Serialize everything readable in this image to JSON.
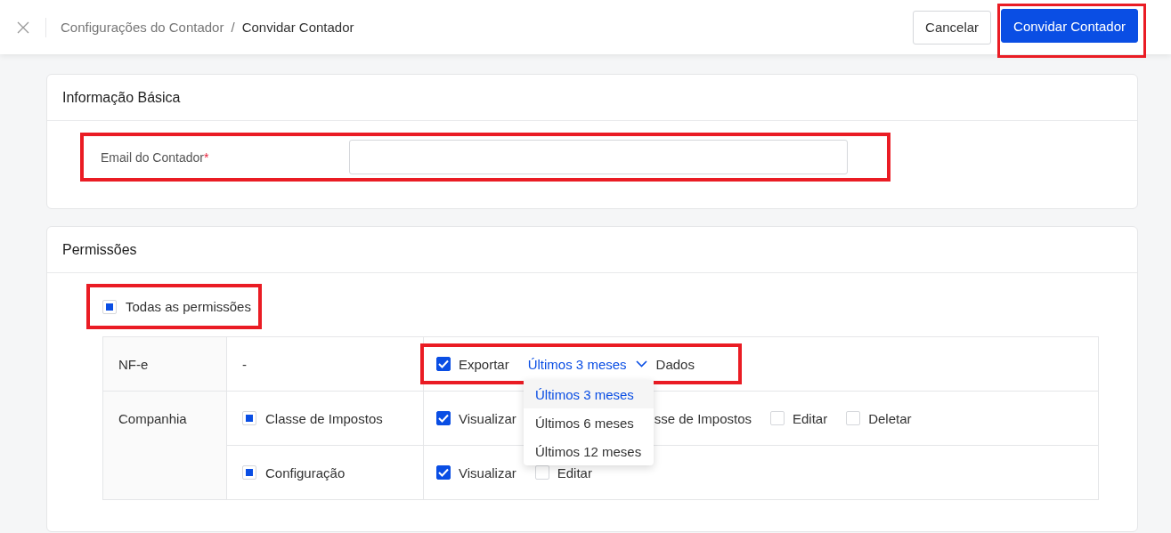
{
  "header": {
    "breadcrumb": [
      {
        "label": "Configurações do Contador",
        "current": false
      },
      {
        "label": "Convidar Contador",
        "current": true
      }
    ],
    "separator": "/",
    "buttons": [
      {
        "label": "Cancelar",
        "kind": "secondary",
        "highlighted": false
      },
      {
        "label": "Convidar Contador",
        "kind": "primary",
        "highlighted": true
      }
    ]
  },
  "basic_info": {
    "title": "Informação Básica",
    "email_field": {
      "label": "Email do Contador",
      "required_mark": "*",
      "highlighted": true
    }
  },
  "permissions": {
    "title": "Permissões",
    "all": {
      "label": "Todas as permissões",
      "checked": false,
      "indeterminate": true,
      "highlighted": true
    },
    "modules": [
      {
        "name": "NF-e",
        "features": [
          {
            "kind": "text",
            "label": "-",
            "highlighted": true,
            "actions": [
              {
                "kind": "check",
                "label": "Exportar",
                "checked": true,
                "indeterminate": false
              },
              {
                "kind": "select",
                "value": "Últimos 3 meses",
                "open": true,
                "options": [
                  {
                    "label": "Últimos 3 meses",
                    "selected": true
                  },
                  {
                    "label": "Últimos 6 meses",
                    "selected": false
                  },
                  {
                    "label": "Últimos 12 meses",
                    "selected": false
                  }
                ]
              },
              {
                "kind": "text",
                "label": "Dados"
              }
            ]
          }
        ]
      },
      {
        "name": "Companhia",
        "features": [
          {
            "kind": "check",
            "label": "Classe de Impostos",
            "checked": false,
            "indeterminate": true,
            "highlighted": false,
            "actions": [
              {
                "kind": "check",
                "label": "Visualizar",
                "checked": true,
                "indeterminate": false
              },
              {
                "kind": "covered",
                "label": "sse de Impostos"
              },
              {
                "kind": "check",
                "label": "Editar",
                "checked": false,
                "indeterminate": false
              },
              {
                "kind": "check",
                "label": "Deletar",
                "checked": false,
                "indeterminate": false
              }
            ]
          },
          {
            "kind": "check",
            "label": "Configuração",
            "checked": false,
            "indeterminate": true,
            "highlighted": false,
            "actions": [
              {
                "kind": "check",
                "label": "Visualizar",
                "checked": true,
                "indeterminate": false
              },
              {
                "kind": "check",
                "label": "Editar",
                "checked": false,
                "indeterminate": false
              }
            ]
          }
        ]
      }
    ]
  }
}
